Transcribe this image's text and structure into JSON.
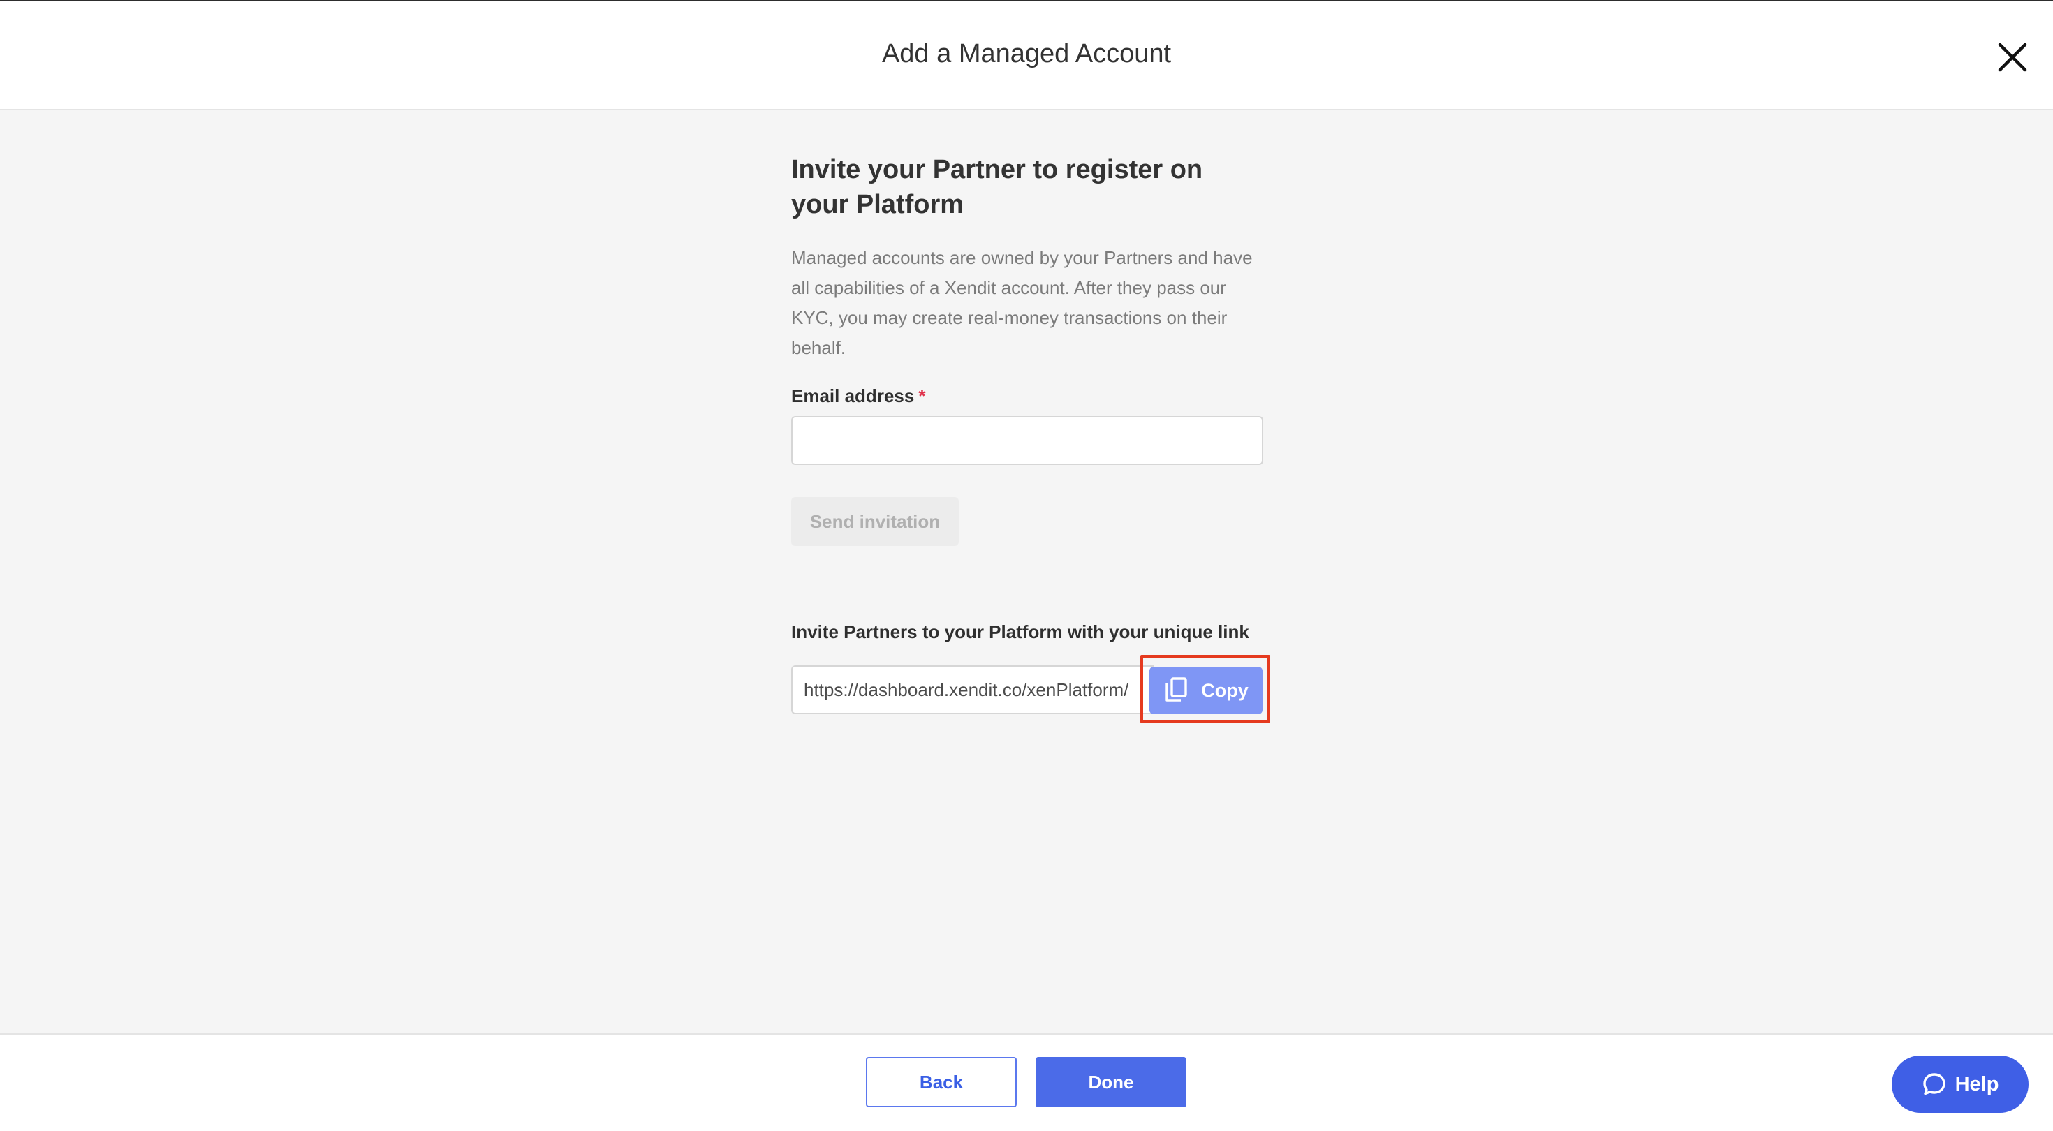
{
  "header": {
    "title": "Add a Managed Account",
    "close_icon": "close-icon"
  },
  "invite": {
    "title": "Invite your Partner to register on your Platform",
    "description": "Managed accounts are owned by your Partners and have all capabilities of a Xendit account. After they pass our KYC, you may create real-money transactions on their behalf.",
    "email_label": "Email address",
    "required_mark": "*",
    "email_value": "",
    "email_placeholder": "",
    "send_button": "Send invitation"
  },
  "link": {
    "label": "Invite Partners to your Platform with your unique link",
    "url": "https://dashboard.xendit.co/xenPlatform/",
    "copy_label": "Copy",
    "copy_icon": "copy-icon"
  },
  "footer": {
    "back_label": "Back",
    "done_label": "Done",
    "help_label": "Help",
    "help_icon": "chat-bubble-icon"
  },
  "colors": {
    "primary": "#4b6be8",
    "copy_button": "#7f96f5",
    "highlight": "#e53a1f",
    "required": "#e0324b"
  }
}
